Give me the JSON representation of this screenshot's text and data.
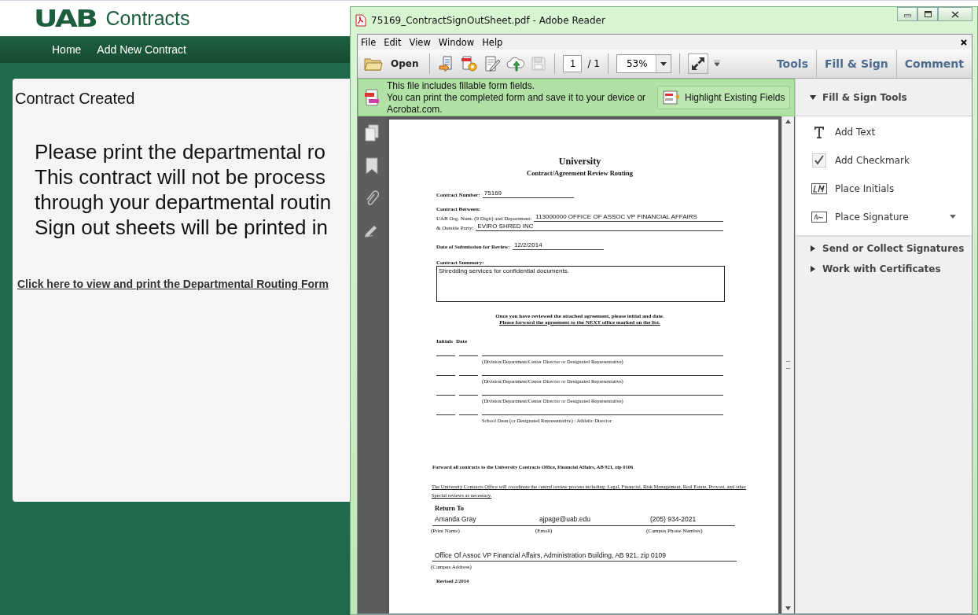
{
  "site": {
    "logo": "UAB",
    "title": "Contracts",
    "nav": [
      "Home",
      "Add New Contract"
    ]
  },
  "content": {
    "heading": "Contract Created",
    "message_lines": [
      "Please print the departmental ro",
      "This contract will not be process",
      "through your departmental routin",
      "Sign out sheets will be printed in"
    ],
    "link": "Click here to view and print the Departmental Routing Form"
  },
  "reader": {
    "title": "75169_ContractSignOutSheet.pdf - Adobe Reader",
    "menu": [
      "File",
      "Edit",
      "View",
      "Window",
      "Help"
    ],
    "toolbar": {
      "open": "Open",
      "page": "1",
      "page_total": "/ 1",
      "zoom": "53%",
      "panels": [
        "Tools",
        "Fill & Sign",
        "Comment"
      ]
    },
    "notice": {
      "lines": [
        "This file includes fillable form fields.",
        "You can print the completed form and save it to your device or Acrobat.com."
      ],
      "button": "Highlight Existing Fields"
    },
    "fill_sign": {
      "heading": "Fill & Sign Tools",
      "expanded": true,
      "tools": [
        {
          "label": "Add Text",
          "kind": "text"
        },
        {
          "label": "Add Checkmark",
          "kind": "check"
        },
        {
          "label": "Place Initials",
          "kind": "initials"
        },
        {
          "label": "Place Signature",
          "kind": "signature"
        }
      ],
      "sections": [
        {
          "label": "Send or Collect Signatures",
          "expanded": false
        },
        {
          "label": "Work with Certificates",
          "expanded": false
        }
      ]
    }
  },
  "document": {
    "title": "University",
    "subtitle": "Contract/Agreement Review Routing",
    "contract_number": {
      "label": "Contract Number:",
      "value": "75169"
    },
    "between_label": "Contract Between:",
    "department": {
      "label": "UAB Org. Num. (9 Digit) and Department:",
      "value": "113000000 OFFICE OF ASSOC VP FINANCIAL AFFAIRS"
    },
    "party": {
      "label": "& Outside Party:",
      "value": "EVIRO SHRED INC"
    },
    "date": {
      "label": "Date of Submission for Review:",
      "value": "12/2/2014"
    },
    "summary": {
      "label": "Contract Summary:",
      "value": "Shredding services for confidential documents."
    },
    "instruction": "Once you have reviewed the attached agreement, please initial and date.",
    "forward_note": "Please forward the agreement to the NEXT office marked on the list.",
    "sign_headers": [
      "Initials",
      "Date"
    ],
    "signoffs": [
      "(Division/Department/Center Director or Designated Representative)",
      "(Division/Department/Center Director or Designated Representative)",
      "(Division/Department/Center Director or Designated Representative)",
      "School Dean (or Designated Representative) / Athletic Director"
    ],
    "forward": "Forward all contracts to the University Contracts Office, Financial Affairs, AB 921, zip 0106",
    "coordinate": "The University Contracts Office will coordinate the central review process including: Legal, Financial, Risk Management, Real Estate, Provost, and other Special reviews as necessary.",
    "return_heading": "Return To",
    "return_fields": [
      {
        "value": "Amanda Gray",
        "label": "(Print Name)"
      },
      {
        "value": "ajpage@uab.edu",
        "label": "(Email)"
      },
      {
        "value": "(205) 934-2021",
        "label": "(Campus Phone Number)"
      }
    ],
    "address": {
      "value": "Office Of Assoc VP Financial Affairs, Administration Building, AB 921, zip 0109",
      "label": "(Campus Address)"
    },
    "revised": "Revised 2/2014"
  }
}
